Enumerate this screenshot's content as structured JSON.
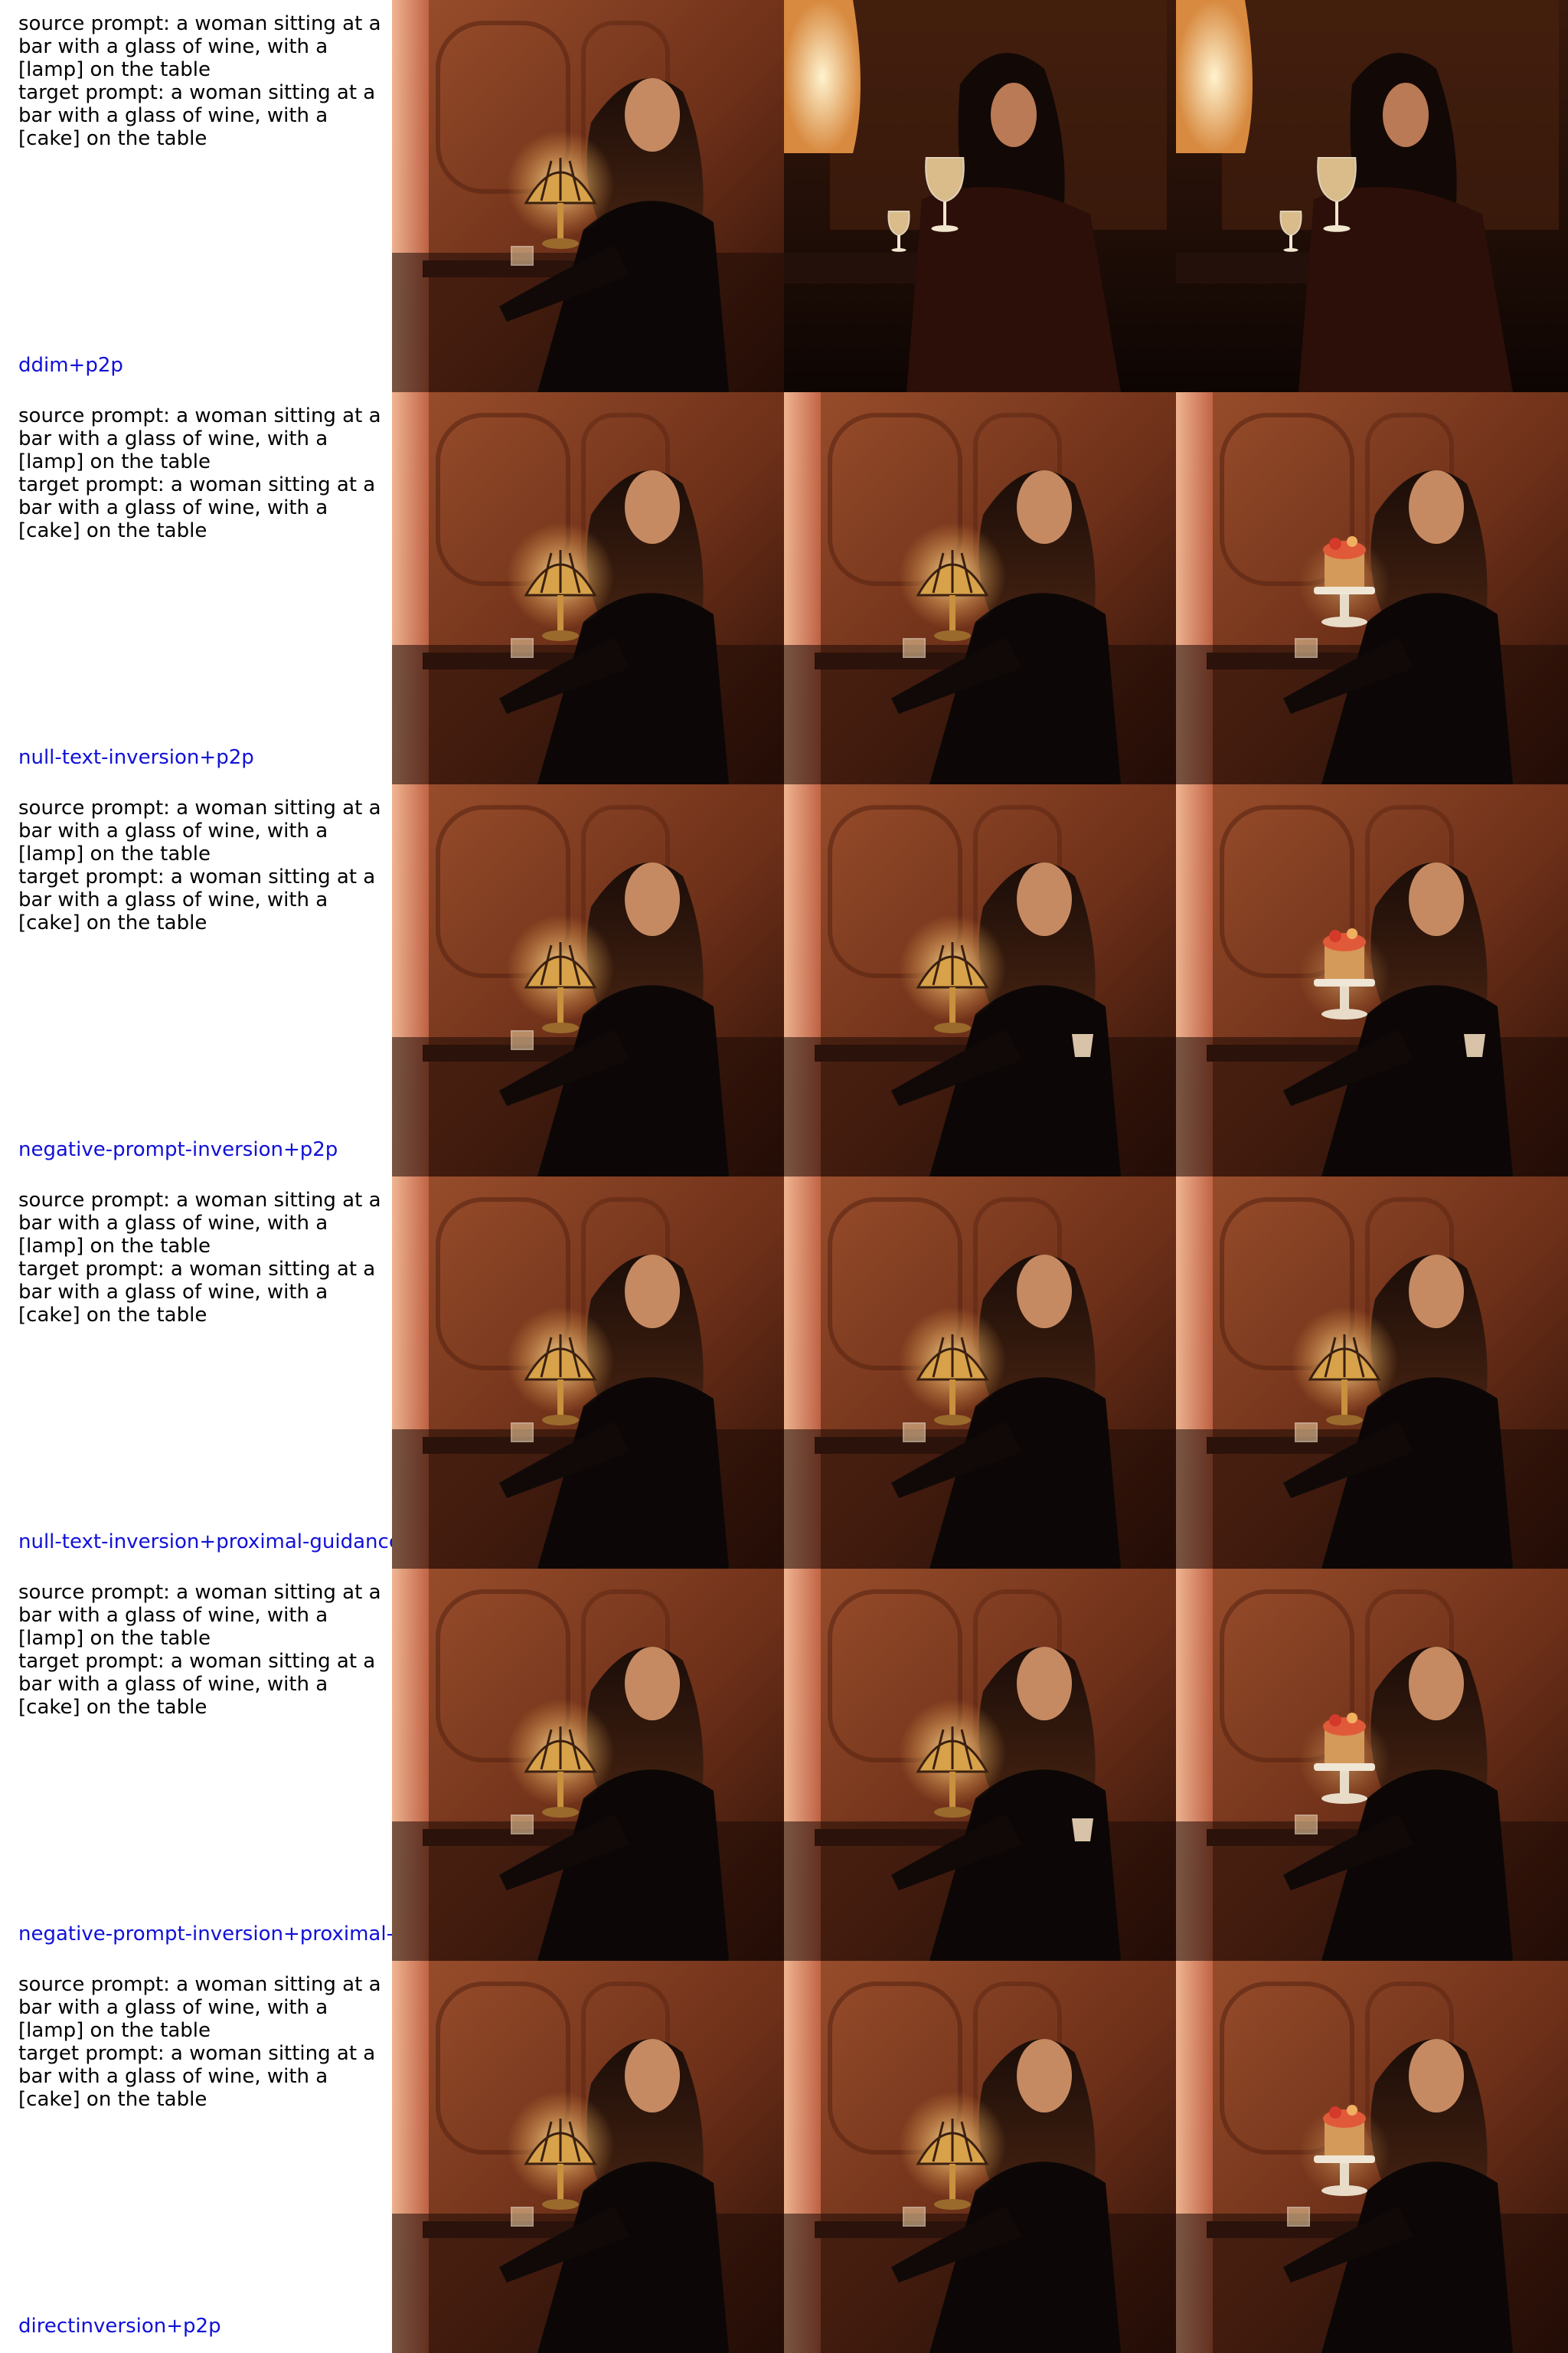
{
  "rows": [
    {
      "source_prompt": "source prompt: a woman sitting at a bar with a glass of wine, with a [lamp] on the table",
      "target_prompt": "target prompt: a woman sitting at a bar with a glass of wine, with a [cake] on the table",
      "method": "ddim+p2p"
    },
    {
      "source_prompt": "source prompt: a woman sitting at a bar with a glass of wine, with a [lamp] on the table",
      "target_prompt": "target prompt: a woman sitting at a bar with a glass of wine, with a [cake] on the table",
      "method": "null-text-inversion+p2p"
    },
    {
      "source_prompt": "source prompt: a woman sitting at a bar with a glass of wine, with a [lamp] on the table",
      "target_prompt": "target prompt: a woman sitting at a bar with a glass of wine, with a [cake] on the table",
      "method": "negative-prompt-inversion+p2p"
    },
    {
      "source_prompt": "source prompt: a woman sitting at a bar with a glass of wine, with a [lamp] on the table",
      "target_prompt": "target prompt: a woman sitting at a bar with a glass of wine, with a [cake] on the table",
      "method": "null-text-inversion+proximal-guidance"
    },
    {
      "source_prompt": "source prompt: a woman sitting at a bar with a glass of wine, with a [lamp] on the table",
      "target_prompt": "target prompt: a woman sitting at a bar with a glass of wine, with a [cake] on the table",
      "method": "negative-prompt-inversion+proximal-g"
    },
    {
      "source_prompt": "source prompt: a woman sitting at a bar with a glass of wine, with a [lamp] on the table",
      "target_prompt": "target prompt: a woman sitting at a bar with a glass of wine, with a [cake] on the table",
      "method": "directinversion+p2p"
    }
  ],
  "colors": {
    "method_label": "#1010d8",
    "prompt_text": "#000000",
    "background": "#ffffff"
  }
}
